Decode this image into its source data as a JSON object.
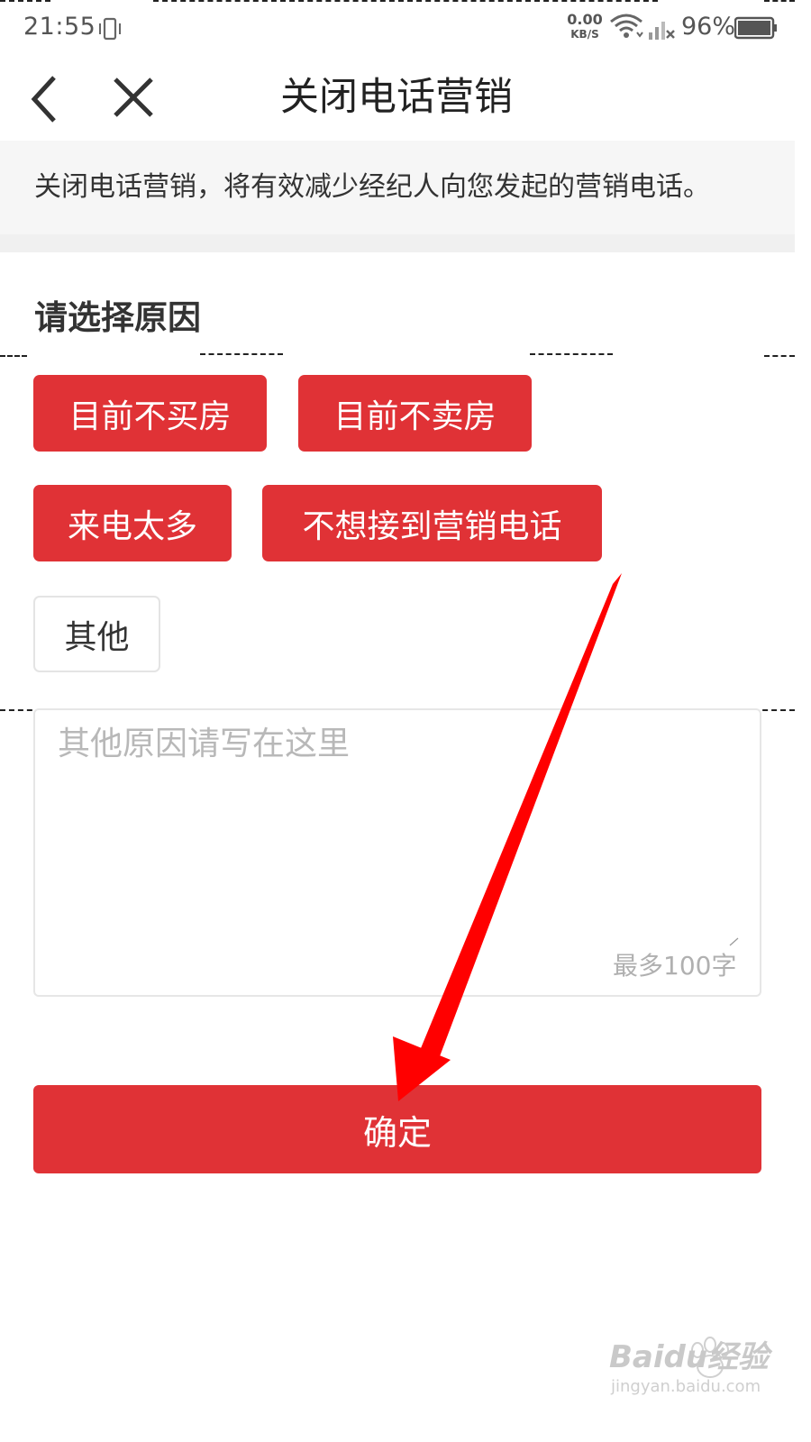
{
  "status_bar": {
    "time": "21:55",
    "speed_value": "0.00",
    "speed_unit": "KB/S",
    "battery": "96%"
  },
  "nav": {
    "title": "关闭电话营销",
    "back_icon": "chevron-left-icon",
    "close_icon": "close-icon"
  },
  "notice": "关闭电话营销，将有效减少经纪人向您发起的营销电话。",
  "section_title": "请选择原因",
  "reasons": [
    {
      "label": "目前不买房",
      "selected": true
    },
    {
      "label": "目前不卖房",
      "selected": true
    },
    {
      "label": "来电太多",
      "selected": true
    },
    {
      "label": "不想接到营销电话",
      "selected": true
    },
    {
      "label": "其他",
      "selected": false
    }
  ],
  "other_input": {
    "placeholder": "其他原因请写在这里",
    "value": "",
    "limit_hint": "最多100字"
  },
  "confirm_label": "确定",
  "watermark": {
    "brand": "Baidu经验",
    "url": "jingyan.baidu.com"
  },
  "colors": {
    "accent": "#e03236",
    "annotation_arrow": "#ff0000"
  }
}
